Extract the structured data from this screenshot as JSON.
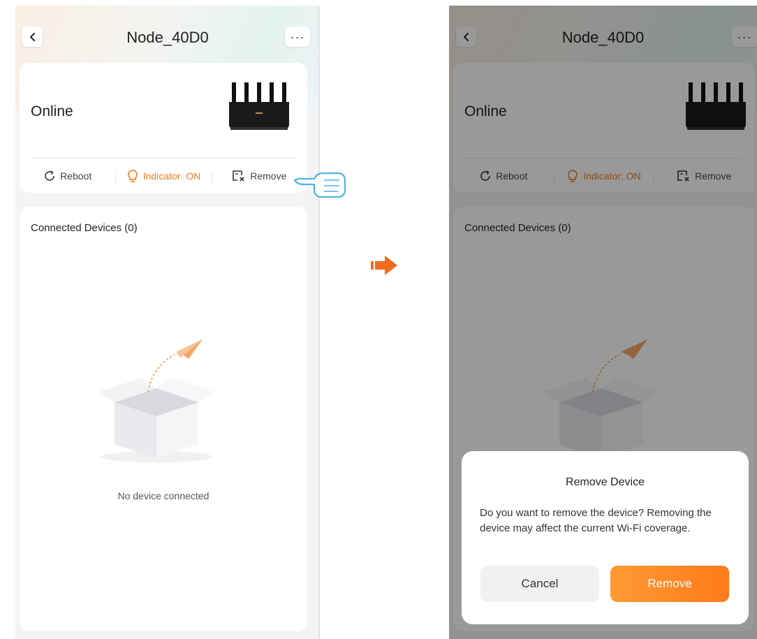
{
  "left_screen": {
    "header": {
      "title": "Node_40D0",
      "back_icon": "chevron-left-icon",
      "more_label": "···"
    },
    "status": {
      "text": "Online"
    },
    "actions": [
      {
        "label": "Reboot",
        "icon": "reboot-icon"
      },
      {
        "label": "Indicator: ON",
        "icon": "lightbulb-icon",
        "color": "#f07f1d"
      },
      {
        "label": "Remove",
        "icon": "remove-device-icon"
      }
    ],
    "devices": {
      "title": "Connected Devices (0)",
      "empty_text": "No device connected"
    }
  },
  "right_screen": {
    "header": {
      "title": "Node_40D0",
      "more_label": "···"
    },
    "status": {
      "text": "Online"
    },
    "actions": [
      {
        "label": "Reboot"
      },
      {
        "label": "Indicator: ON"
      },
      {
        "label": "Remove"
      }
    ],
    "devices": {
      "title": "Connected Devices (0)"
    },
    "dialog": {
      "title": "Remove Device",
      "message": "Do you want to remove the device? Removing the device may affect the current Wi-Fi coverage.",
      "cancel_label": "Cancel",
      "confirm_label": "Remove"
    }
  },
  "colors": {
    "accent": "#f07f1d",
    "remove_button": "#ff8a26"
  }
}
